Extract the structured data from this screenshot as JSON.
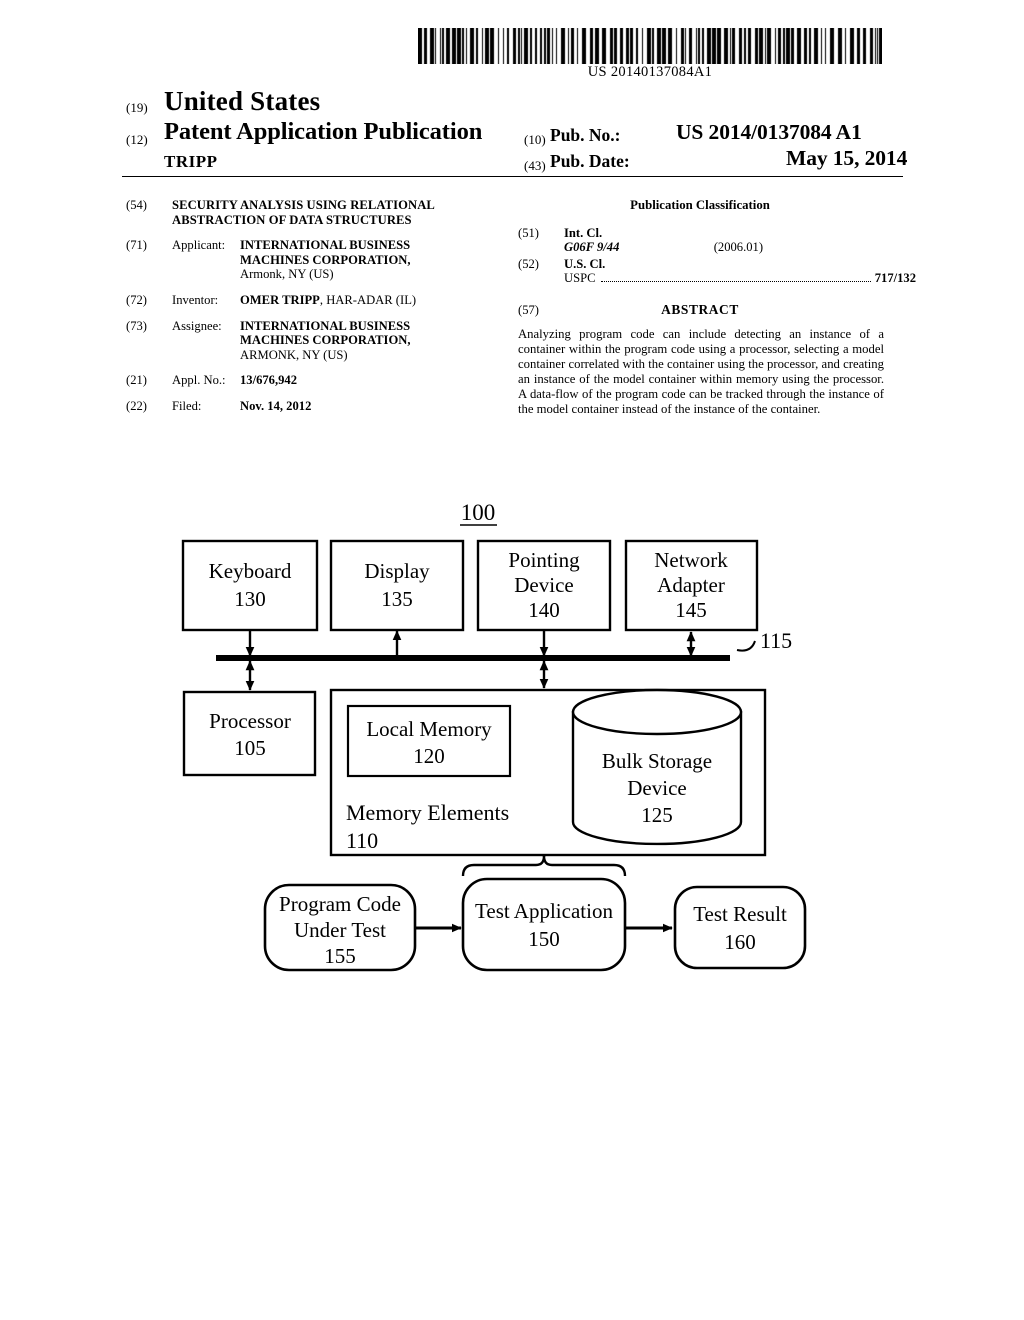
{
  "barcode": {
    "icon": "barcode-icon",
    "number": "US 20140137084A1"
  },
  "header": {
    "kind_19": "(19)",
    "country": "United States",
    "kind_12": "(12)",
    "publication_type": "Patent Application Publication",
    "inventor_surname": "TRIPP",
    "kind_10": "(10)",
    "pub_no_label": "Pub. No.:",
    "pub_no_value": "US 2014/0137084 A1",
    "kind_43": "(43)",
    "pub_date_label": "Pub. Date:",
    "pub_date_value": "May 15, 2014"
  },
  "biblio_left": {
    "title_num": "(54)",
    "title_line1": "SECURITY ANALYSIS USING RELATIONAL",
    "title_line2": "ABSTRACTION OF DATA STRUCTURES",
    "applicant_num": "(71)",
    "applicant_label": "Applicant:",
    "applicant_line1": "INTERNATIONAL BUSINESS",
    "applicant_line2": "MACHINES CORPORATION,",
    "applicant_line3": "Armonk, NY (US)",
    "inventor_num": "(72)",
    "inventor_label": "Inventor:",
    "inventor_name": "OMER TRIPP",
    "inventor_location": ", HAR-ADAR (IL)",
    "assignee_num": "(73)",
    "assignee_label": "Assignee:",
    "assignee_line1": "INTERNATIONAL BUSINESS",
    "assignee_line2": "MACHINES CORPORATION,",
    "assignee_line3": "ARMONK, NY (US)",
    "appl_no_num": "(21)",
    "appl_no_label": "Appl. No.:",
    "appl_no_value": "13/676,942",
    "filed_num": "(22)",
    "filed_label": "Filed:",
    "filed_value": "Nov. 14, 2012"
  },
  "biblio_right": {
    "pub_class_heading": "Publication Classification",
    "int_cl_num": "(51)",
    "int_cl_label": "Int. Cl.",
    "int_cl_value": "G06F 9/44",
    "int_cl_version": "(2006.01)",
    "us_cl_num": "(52)",
    "us_cl_label": "U.S. Cl.",
    "uspc_label": "USPC",
    "uspc_value": "717/132",
    "abstract_num": "(57)",
    "abstract_title": "ABSTRACT",
    "abstract_text": "Analyzing program code can include detecting an instance of a container within the program code using a processor, selecting a model container correlated with the container using the processor, and creating an instance of the model container within memory using the processor. A data-flow of the program code can be tracked through the instance of the model container instead of the instance of the container."
  },
  "figure": {
    "figure_label": "100",
    "bus_label": "115",
    "nodes": {
      "keyboard": {
        "title": "Keyboard",
        "ref": "130"
      },
      "display": {
        "title": "Display",
        "ref": "135"
      },
      "pointing_device": {
        "title_line1": "Pointing",
        "title_line2": "Device",
        "ref": "140"
      },
      "network_adapter": {
        "title_line1": "Network",
        "title_line2": "Adapter",
        "ref": "145"
      },
      "processor": {
        "title": "Processor",
        "ref": "105"
      },
      "memory_elements": {
        "title": "Memory Elements",
        "ref": "110"
      },
      "local_memory": {
        "title": "Local Memory",
        "ref": "120"
      },
      "bulk_storage": {
        "title_line1": "Bulk Storage",
        "title_line2": "Device",
        "ref": "125"
      },
      "program_code": {
        "title_line1": "Program Code",
        "title_line2": "Under Test",
        "ref": "155"
      },
      "test_application": {
        "title": "Test Application",
        "ref": "150"
      },
      "test_result": {
        "title": "Test Result",
        "ref": "160"
      }
    }
  }
}
